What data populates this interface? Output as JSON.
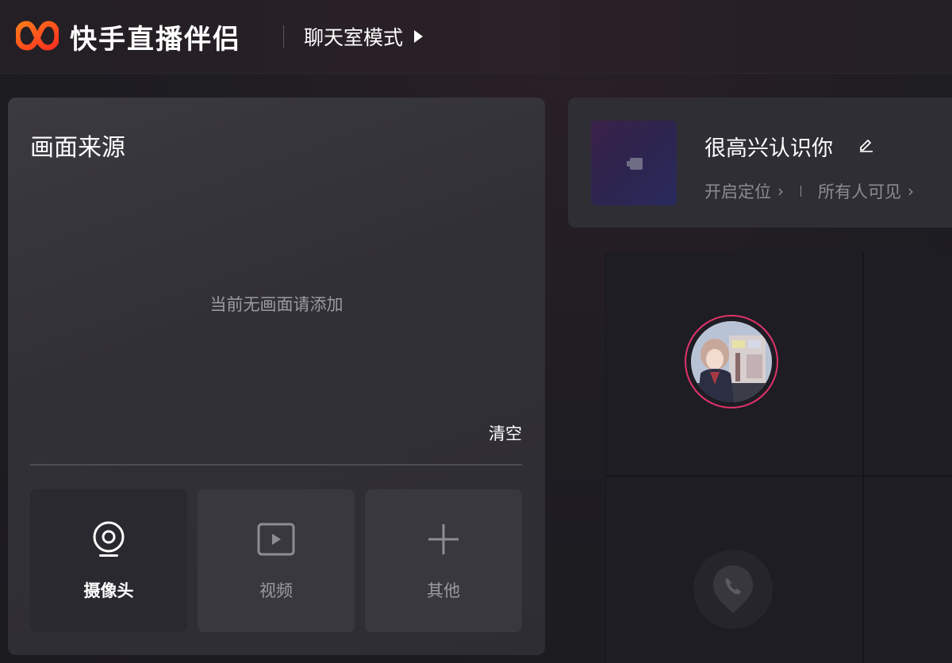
{
  "header": {
    "app_title": "快手直播伴侣",
    "mode_label": "聊天室模式"
  },
  "source_panel": {
    "title": "画面来源",
    "empty_hint": "当前无画面请添加",
    "clear_label": "清空",
    "tiles": [
      {
        "label": "摄像头",
        "icon": "camera-icon"
      },
      {
        "label": "视频",
        "icon": "video-play-icon"
      },
      {
        "label": "其他",
        "icon": "plus-icon"
      }
    ]
  },
  "room": {
    "title": "很高兴认识你",
    "location_label": "开启定位",
    "visibility_label": "所有人可见"
  },
  "colors": {
    "brand_orange": "#ff4a1a",
    "avatar_ring": "#e0336a"
  }
}
